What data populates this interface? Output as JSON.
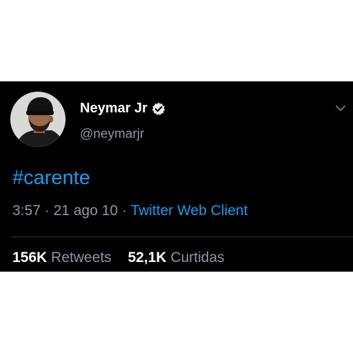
{
  "tweet": {
    "display_name": "Neymar Jr",
    "handle": "@neymarjr",
    "verified": true,
    "text": "#carente",
    "time": "3:57",
    "date": "21 ago 10",
    "separator": "·",
    "source": "Twitter Web Client",
    "retweets": {
      "count": "156K",
      "label": "Retweets"
    },
    "likes": {
      "count": "52,1K",
      "label": "Curtidas"
    }
  },
  "icons": {
    "verified": "verified-badge-icon",
    "menu": "chevron-down-icon"
  },
  "colors": {
    "background": "#000000",
    "accent": "#1d9bf0",
    "secondary_text": "#8b98a5",
    "primary_text": "#ffffff"
  }
}
